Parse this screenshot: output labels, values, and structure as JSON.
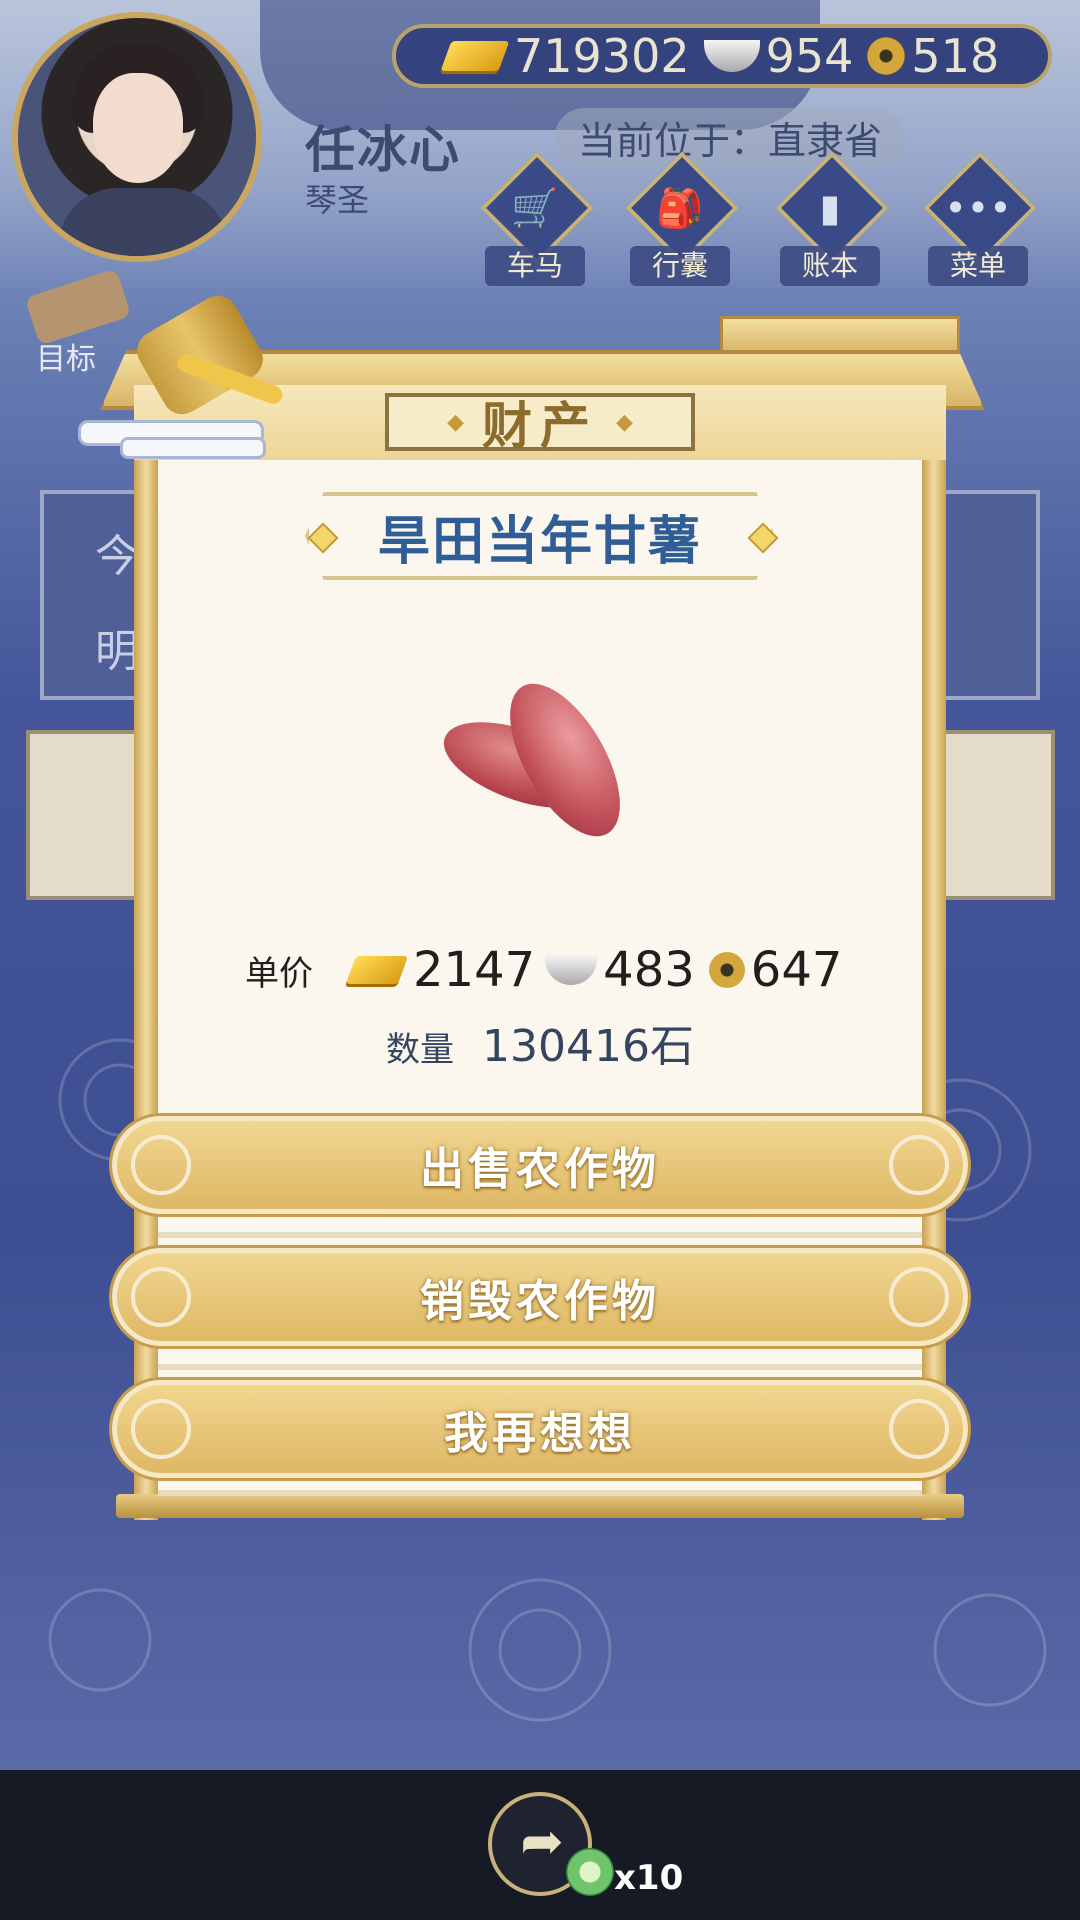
{
  "header": {
    "player_name": "任冰心",
    "player_title": "琴圣",
    "location_label": "当前位于：直隶省",
    "currency": {
      "gold": "719302",
      "silver": "954",
      "copper": "518"
    }
  },
  "nav": [
    {
      "label": "车马",
      "glyph": "🛒"
    },
    {
      "label": "行囊",
      "glyph": "🎒"
    },
    {
      "label": "账本",
      "glyph": "▮"
    },
    {
      "label": "菜单",
      "glyph": "•••"
    }
  ],
  "goal_label": "目标",
  "background": {
    "side_text_1": "今",
    "side_text_2": "明"
  },
  "dialog": {
    "title": "财产",
    "item_name": "旱田当年甘薯",
    "price_label": "单价",
    "price": {
      "gold": "2147",
      "silver": "483",
      "copper": "647"
    },
    "quantity_label": "数量",
    "quantity_value": "130416石",
    "buttons": {
      "sell": "出售农作物",
      "destroy": "销毁农作物",
      "cancel": "我再想想"
    }
  },
  "bottom": {
    "reward_count": "x10"
  },
  "colors": {
    "accent_gold": "#deb865",
    "item_name_blue": "#2f5e96",
    "background_blue": "#3d4e92"
  }
}
